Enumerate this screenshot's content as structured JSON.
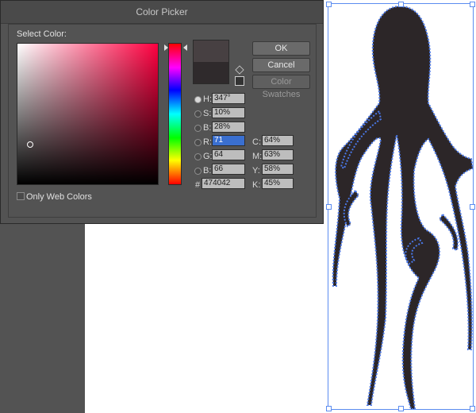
{
  "dialog": {
    "title": "Color Picker",
    "select_label": "Select Color:",
    "buttons": {
      "ok": "OK",
      "cancel": "Cancel",
      "swatches": "Color Swatches"
    },
    "only_web_label": "Only Web Colors"
  },
  "fields": {
    "H": {
      "label": "H:",
      "value": "347°"
    },
    "S": {
      "label": "S:",
      "value": "10%"
    },
    "B": {
      "label": "B:",
      "value": "28%"
    },
    "R": {
      "label": "R:",
      "value": "71"
    },
    "G": {
      "label": "G:",
      "value": "64"
    },
    "Bl": {
      "label": "B:",
      "value": "66"
    },
    "hex": {
      "label": "#",
      "value": "474042"
    },
    "C": {
      "label": "C:",
      "value": "64%"
    },
    "M": {
      "label": "M:",
      "value": "63%"
    },
    "Y": {
      "label": "Y:",
      "value": "58%"
    },
    "K": {
      "label": "K:",
      "value": "45%"
    }
  },
  "colors": {
    "current": "#474042",
    "selection": "#5b8cf0",
    "artwork_fill": "#2c2628"
  }
}
